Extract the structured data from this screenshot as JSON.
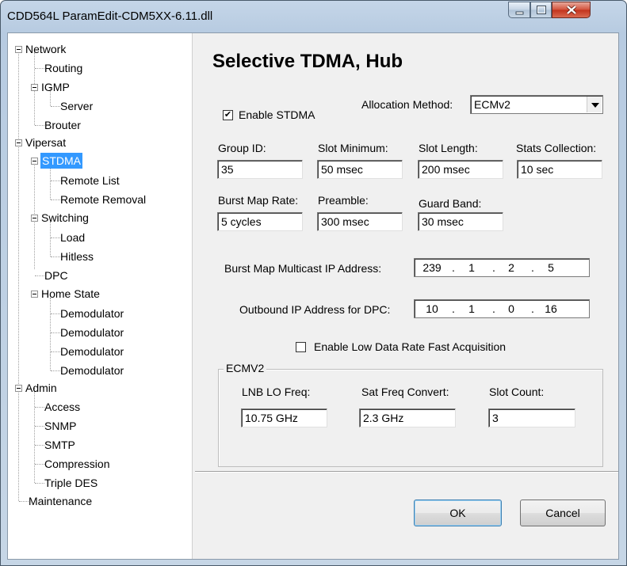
{
  "window": {
    "title": "CDD564L ParamEdit-CDM5XX-6.11.dll",
    "caption_icons": [
      "minimize-icon",
      "maximize-icon",
      "close-icon"
    ]
  },
  "tree": {
    "items": [
      {
        "label": "Network"
      },
      {
        "label": "Routing"
      },
      {
        "label": "IGMP"
      },
      {
        "label": "Server"
      },
      {
        "label": "Brouter"
      },
      {
        "label": "Vipersat"
      },
      {
        "label": "STDMA",
        "selected": true
      },
      {
        "label": "Remote List"
      },
      {
        "label": "Remote Removal"
      },
      {
        "label": "Switching"
      },
      {
        "label": "Load"
      },
      {
        "label": "Hitless"
      },
      {
        "label": "DPC"
      },
      {
        "label": "Home State"
      },
      {
        "label": "Demodulator"
      },
      {
        "label": "Demodulator"
      },
      {
        "label": "Demodulator"
      },
      {
        "label": "Demodulator"
      },
      {
        "label": "Admin"
      },
      {
        "label": "Access"
      },
      {
        "label": "SNMP"
      },
      {
        "label": "SMTP"
      },
      {
        "label": "Compression"
      },
      {
        "label": "Triple DES"
      },
      {
        "label": "Maintenance"
      }
    ],
    "selection_color": "#3399ff"
  },
  "panel": {
    "heading": "Selective TDMA, Hub",
    "enable_stdma": {
      "label": "Enable STDMA",
      "checked": true
    },
    "allocation": {
      "label": "Allocation Method:",
      "value": "ECMv2"
    },
    "group_id": {
      "label": "Group ID:",
      "value": "35"
    },
    "slot_minimum": {
      "label": "Slot Minimum:",
      "value": "50 msec"
    },
    "slot_length": {
      "label": "Slot Length:",
      "value": "200 msec"
    },
    "stats_collection": {
      "label": "Stats Collection:",
      "value": "10 sec"
    },
    "burst_map_rate": {
      "label": "Burst Map Rate:",
      "value": "5 cycles"
    },
    "preamble": {
      "label": "Preamble:",
      "value": "300 msec"
    },
    "guard_band": {
      "label": "Guard Band:",
      "value": "30 msec"
    },
    "burst_map_ip": {
      "label": "Burst Map Multicast IP Address:",
      "octets": [
        "239",
        "1",
        "2",
        "5"
      ]
    },
    "outbound_ip": {
      "label": "Outbound IP Address for DPC:",
      "octets": [
        "10",
        "1",
        "0",
        "16"
      ]
    },
    "low_data_rate": {
      "label": "Enable Low Data Rate Fast Acquisition",
      "checked": false
    },
    "ecmv2": {
      "title": "ECMV2",
      "lnb_lo_freq": {
        "label": "LNB LO Freq:",
        "value": "10.75 GHz"
      },
      "sat_freq_convert": {
        "label": "Sat Freq Convert:",
        "value": "2.3 GHz"
      },
      "slot_count": {
        "label": "Slot Count:",
        "value": "3"
      }
    },
    "buttons": {
      "ok": "OK",
      "cancel": "Cancel"
    }
  }
}
